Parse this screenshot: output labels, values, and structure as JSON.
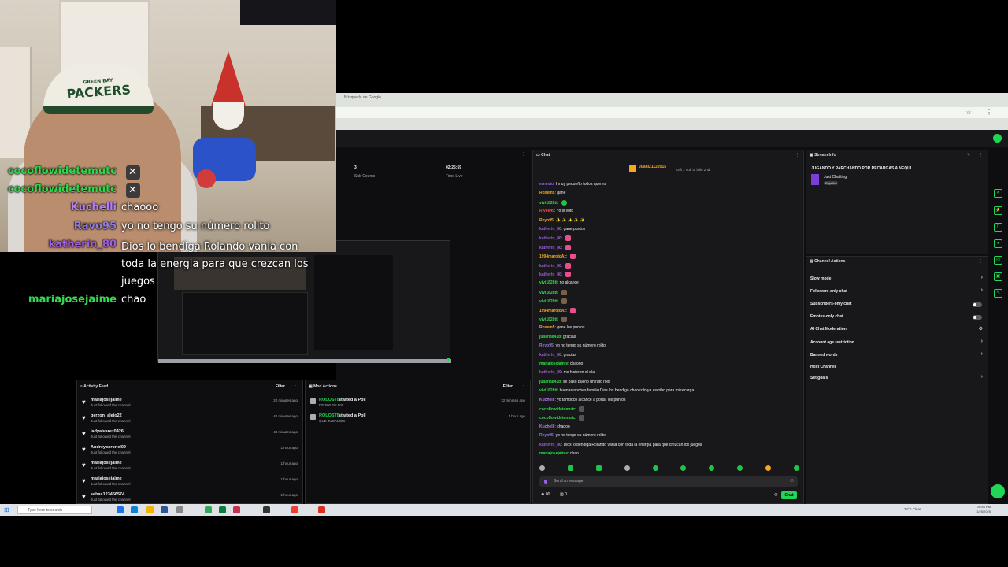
{
  "overlay_chat": [
    {
      "user": "cocoflowidetemutc",
      "text": "",
      "color": "#2bd94a",
      "badge": true
    },
    {
      "user": "cocoflowidetemutc",
      "text": "",
      "color": "#2bd94a",
      "badge": true
    },
    {
      "user": "Kuchelli",
      "text": "chaooo",
      "color": "#b57ff0"
    },
    {
      "user": "Ravo95",
      "text": "yo no tengo su número rolito",
      "color": "#8f7ad6"
    },
    {
      "user": "katherin_80",
      "text": "Dios lo bendiga Rolando vania con toda la energia para que crezcan los juegos",
      "color": "#9d5fd8"
    },
    {
      "user": "mariajosejaime",
      "text": "chao",
      "color": "#2fdc4d"
    }
  ],
  "webcam": {
    "cap_text": "PACKERS",
    "cap_small": "GREEN BAY"
  },
  "browser": {
    "tab_title": "Búsqueda de Google",
    "addr_icons": "☆ ⋮"
  },
  "stats": [
    {
      "value": "3",
      "label": "Sub Counts"
    },
    {
      "value": "02:25:59",
      "label": "Time Live"
    }
  ],
  "activity": {
    "title": "Activity Feed",
    "filter": "Filter",
    "items": [
      {
        "name": "mariajosejaime",
        "sub": "Just followed the channel",
        "time": "20 minutes ago"
      },
      {
        "name": "gerzon_alejo22",
        "sub": "Just followed the channel",
        "time": "42 minutes ago"
      },
      {
        "name": "ladyalvarez0426",
        "sub": "Just followed the channel",
        "time": "44 minutes ago"
      },
      {
        "name": "Andreycoronel09",
        "sub": "Just followed the channel",
        "time": "1 hour ago"
      },
      {
        "name": "mariajosejaime",
        "sub": "Just followed the channel",
        "time": "1 hour ago"
      },
      {
        "name": "mariajosejaime",
        "sub": "Just followed the channel",
        "time": "1 hour ago"
      },
      {
        "name": "sebas123456574",
        "sub": "Just followed the channel",
        "time": "1 hour ago"
      }
    ]
  },
  "mod_actions": {
    "title": "Mod Actions",
    "filter": "Filter",
    "items": [
      {
        "name": "ROLOSTB",
        "action": "started a Poll",
        "detail": "DE 500 EN 500",
        "time": "22 minutes ago"
      },
      {
        "name": "ROLOSTB",
        "action": "started a Poll",
        "detail": "QUE JUGAMOS",
        "time": "1 hour ago"
      }
    ]
  },
  "chat": {
    "title": "Chat",
    "pinned_user": "Juani21122015",
    "pinned_text": "Gift 1 sub to lailo 2nd",
    "input_placeholder": "Send a message",
    "send_label": "Chat",
    "points": "00",
    "count": "0",
    "lines": [
      {
        "user": "ernesto",
        "text": "I muy pequeño todos quemo",
        "color": "#9a5cf0"
      },
      {
        "user": "Roxem5",
        "text": "gane",
        "color": "#f5a623"
      },
      {
        "user": "vivi1828tt",
        "text": "",
        "color": "#2fdc4d",
        "emote": "g"
      },
      {
        "user": "Rivek45",
        "text": "Yo si voto",
        "color": "#ff4545"
      },
      {
        "user": "Reyo95",
        "text": "✨ ✨ ✨ ✨ ✨",
        "color": "#f5a623"
      },
      {
        "user": "katherin_80",
        "text": "gane puntos",
        "color": "#9d5fd8"
      },
      {
        "user": "katherin_80",
        "text": "",
        "color": "#9d5fd8",
        "emote": "p"
      },
      {
        "user": "katherin_80",
        "text": "",
        "color": "#9d5fd8",
        "emote": "p"
      },
      {
        "user": "1994maroloAz",
        "text": "",
        "color": "#f5a623",
        "emote": "p"
      },
      {
        "user": "katherin_80",
        "text": "",
        "color": "#9d5fd8",
        "emote": "p"
      },
      {
        "user": "katherin_80",
        "text": "",
        "color": "#9d5fd8",
        "emote": "p"
      },
      {
        "user": "vivi1828tt",
        "text": "no alcance",
        "color": "#2fdc4d"
      },
      {
        "user": "vivi1828tt",
        "text": "",
        "color": "#2fdc4d",
        "emote": "b"
      },
      {
        "user": "vivi1828tt",
        "text": "",
        "color": "#2fdc4d",
        "emote": "b"
      },
      {
        "user": "1994maroloAz",
        "text": "",
        "color": "#f5a623",
        "emote": "p"
      },
      {
        "user": "vivi1828tt",
        "text": "",
        "color": "#2fdc4d",
        "emote": "b"
      },
      {
        "user": "Roxem5",
        "text": "gane los puntos",
        "color": "#f5a623"
      },
      {
        "user": "julian8841b",
        "text": "gracias",
        "color": "#2fdc4d"
      },
      {
        "user": "Reyo95",
        "text": "yo no tengo su número rolito",
        "color": "#8f7ad6"
      },
      {
        "user": "katherin_80",
        "text": "gracias",
        "color": "#9d5fd8"
      },
      {
        "user": "mariajosejaime",
        "text": "chaooo",
        "color": "#2fdc4d"
      },
      {
        "user": "katherin_80",
        "text": "me hicieron el día",
        "color": "#9d5fd8"
      },
      {
        "user": "julian8841b",
        "text": "se paso bueno un rato rolo",
        "color": "#2fdc4d"
      },
      {
        "user": "vivi1828tt",
        "text": "buenas noches familia Dios los bendiga chao rolo ya escribo para mi recarga",
        "color": "#2fdc4d"
      },
      {
        "user": "Kuchelli",
        "text": "yo tampoco alcancé a portar los puntos",
        "color": "#b57ff0"
      },
      {
        "user": "cocoflowidetemutc",
        "text": "",
        "color": "#2bd94a",
        "emote": "x"
      },
      {
        "user": "cocoflowidetemutc",
        "text": "",
        "color": "#2bd94a",
        "emote": "x"
      },
      {
        "user": "Kuchelli",
        "text": "chaooo",
        "color": "#b57ff0"
      },
      {
        "user": "Reyo95",
        "text": "yo no tengo su número rolito",
        "color": "#8f7ad6"
      },
      {
        "user": "katherin_80",
        "text": "Dios lo bendiga Rolando vania con toda la energia para que crezcan los juegos",
        "color": "#9d5fd8"
      },
      {
        "user": "mariajosejaime",
        "text": "chao",
        "color": "#2fdc4d"
      }
    ]
  },
  "stream_info": {
    "title": "Stream Info",
    "stream_title": "JUGANDO Y PARCHANDO POR RECARGAS A NEQUI",
    "category": "Just Chatting",
    "tag": "Español"
  },
  "channel_actions": {
    "title": "Channel Actions",
    "items": [
      {
        "label": "Slow mode",
        "control": "chevron"
      },
      {
        "label": "Followers-only chat",
        "control": "chevron"
      },
      {
        "label": "Subscribers-only chat",
        "control": "toggle"
      },
      {
        "label": "Emotes-only chat",
        "control": "toggle"
      },
      {
        "label": "AI Chat Moderation",
        "control": "settings"
      },
      {
        "label": "Account age restriction",
        "control": "chevron"
      },
      {
        "label": "Banned words",
        "control": "chevron"
      },
      {
        "label": "Host Channel",
        "control": "none"
      },
      {
        "label": "Set goals",
        "control": "chevron"
      }
    ]
  },
  "taskbar": {
    "search_placeholder": "Type here to search",
    "clock_time": "10:55 PM",
    "clock_date": "1/25/2025",
    "weather": "74°F Clear"
  },
  "colors": {
    "accent": "#1fd655",
    "panel": "#18181b",
    "bg": "#0e0e10"
  }
}
